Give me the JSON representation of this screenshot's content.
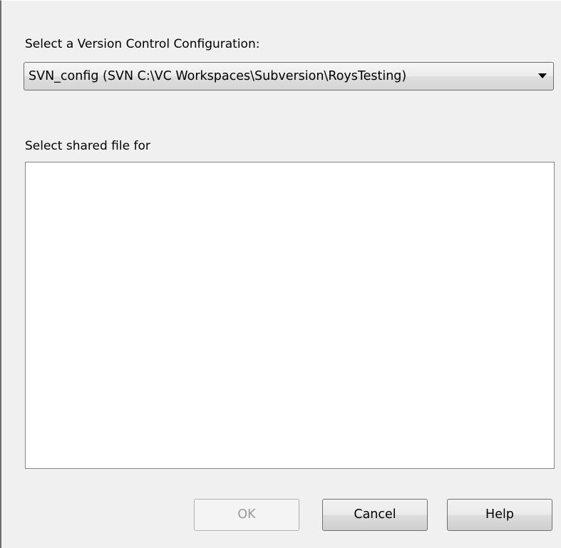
{
  "config": {
    "label": "Select a Version Control Configuration:",
    "selected_value": "SVN_config (SVN C:\\VC Workspaces\\Subversion\\RoysTesting)"
  },
  "shared_file": {
    "label": "Select shared file for",
    "items": []
  },
  "buttons": {
    "ok_label": "OK",
    "ok_enabled": false,
    "cancel_label": "Cancel",
    "help_label": "Help"
  }
}
